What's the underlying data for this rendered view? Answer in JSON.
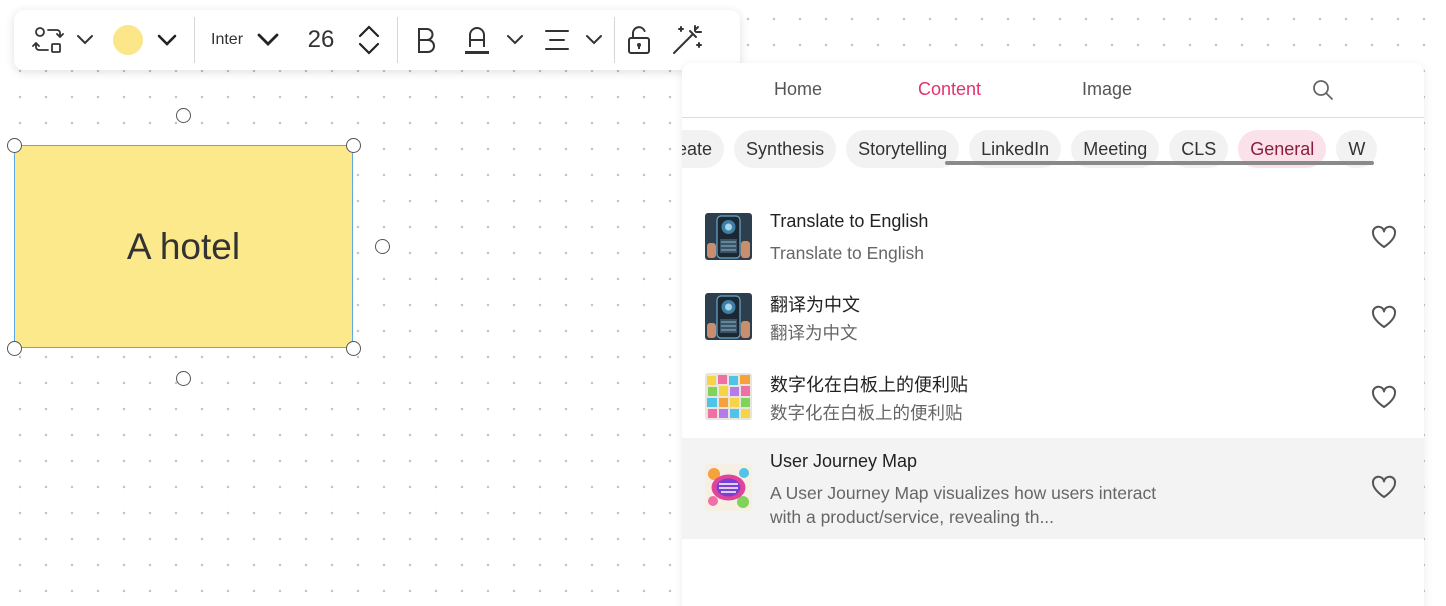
{
  "toolbar": {
    "icons": [
      "shape-swap-icon",
      "chevron-down-icon",
      "fill-color",
      "chevron-down-icon",
      "chevron-down-icon",
      "chevron-up-icon",
      "chevron-down-icon",
      "bold-icon",
      "text-color-icon",
      "chevron-down-icon",
      "align-icon",
      "chevron-down-icon",
      "unlock-icon",
      "magic-wand-icon"
    ],
    "fill_color": "#fce68a",
    "font_name": "Inter",
    "font_size": "26"
  },
  "canvas": {
    "sticky_text": "A hotel",
    "sticky_color": "#fce98c",
    "selection_color": "#5fa8e0"
  },
  "panel": {
    "tabs": [
      {
        "label": "Home",
        "active": false
      },
      {
        "label": "Content",
        "active": true
      },
      {
        "label": "Image",
        "active": false
      }
    ],
    "accent_color": "#e2336b",
    "chips": [
      {
        "label": "Ideate",
        "active": false
      },
      {
        "label": "Synthesis",
        "active": false
      },
      {
        "label": "Storytelling",
        "active": false
      },
      {
        "label": "LinkedIn",
        "active": false
      },
      {
        "label": "Meeting",
        "active": false
      },
      {
        "label": "CLS",
        "active": false
      },
      {
        "label": "General",
        "active": true
      },
      {
        "label": "W",
        "active": false
      }
    ],
    "items": [
      {
        "title": "Translate to English",
        "subtitle": "Translate to English",
        "thumb": "phone-translate-image",
        "favorite": false
      },
      {
        "title": "翻译为中文",
        "subtitle": "翻译为中文",
        "thumb": "phone-translate-image",
        "favorite": false
      },
      {
        "title": "数字化在白板上的便利贴",
        "subtitle": "数字化在白板上的便利贴",
        "thumb": "sticky-notes-image",
        "favorite": false
      },
      {
        "title": "User Journey Map",
        "subtitle": "A User Journey Map visualizes how users interact with a product/service, revealing th...",
        "thumb": "user-journey-map-image",
        "favorite": false
      }
    ]
  }
}
